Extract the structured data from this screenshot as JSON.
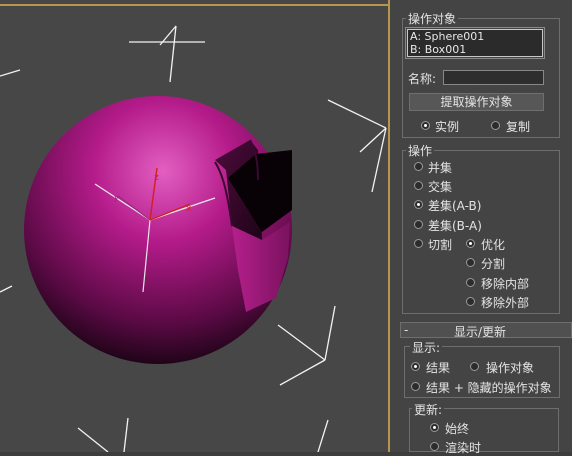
{
  "operands_group": {
    "title": "操作对象",
    "items": [
      "A: Sphere001",
      "B: Box001"
    ],
    "name_label": "名称:",
    "name_value": "",
    "pick_button": "提取操作对象",
    "pick_mode": {
      "instance": "实例",
      "copy": "复制",
      "selected": "instance"
    }
  },
  "operation_group": {
    "title": "操作",
    "options": [
      "并集",
      "交集",
      "差集(A-B)",
      "差集(B-A)",
      "切割"
    ],
    "selected": "差集(A-B)",
    "cut_options": [
      "优化",
      "分割",
      "移除内部",
      "移除外部"
    ],
    "cut_selected": "优化"
  },
  "display_update_rollout": {
    "toggle": "-",
    "title": "显示/更新",
    "display": {
      "title": "显示:",
      "result": "结果",
      "operands": "操作对象",
      "result_hidden": "结果 + 隐藏的操作对象",
      "selected": "结果"
    },
    "update": {
      "title": "更新:",
      "always": "始终",
      "on_render": "渲染时",
      "selected": "始终"
    }
  },
  "colors": {
    "viewport_bg": "#474747",
    "viewport_border": "#b4964e",
    "sphere": "#c0208e",
    "panel_bg": "#444444"
  },
  "icons": {
    "gizmo": "transform-gizmo-icon",
    "camera_lights": "light-icon"
  }
}
